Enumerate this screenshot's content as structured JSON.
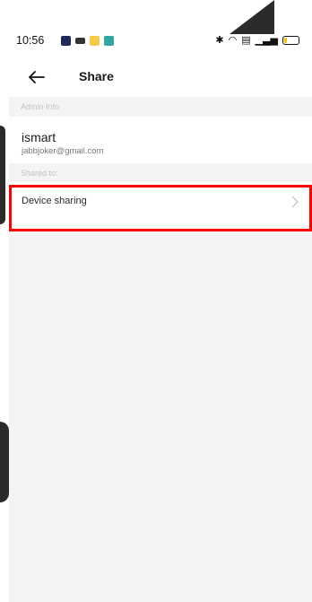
{
  "status_bar": {
    "time": "10:56"
  },
  "app_bar": {
    "title": "Share"
  },
  "admin_info": {
    "section_label": "Admin Info",
    "name": "ismart",
    "email": "jabbjoker@gmail.com"
  },
  "shared_to": {
    "section_label": "Shared to:",
    "rows": [
      {
        "label": "Device sharing"
      }
    ]
  },
  "colors": {
    "highlight": "#ff0000",
    "background": "#f4f4f4",
    "card": "#ffffff"
  }
}
